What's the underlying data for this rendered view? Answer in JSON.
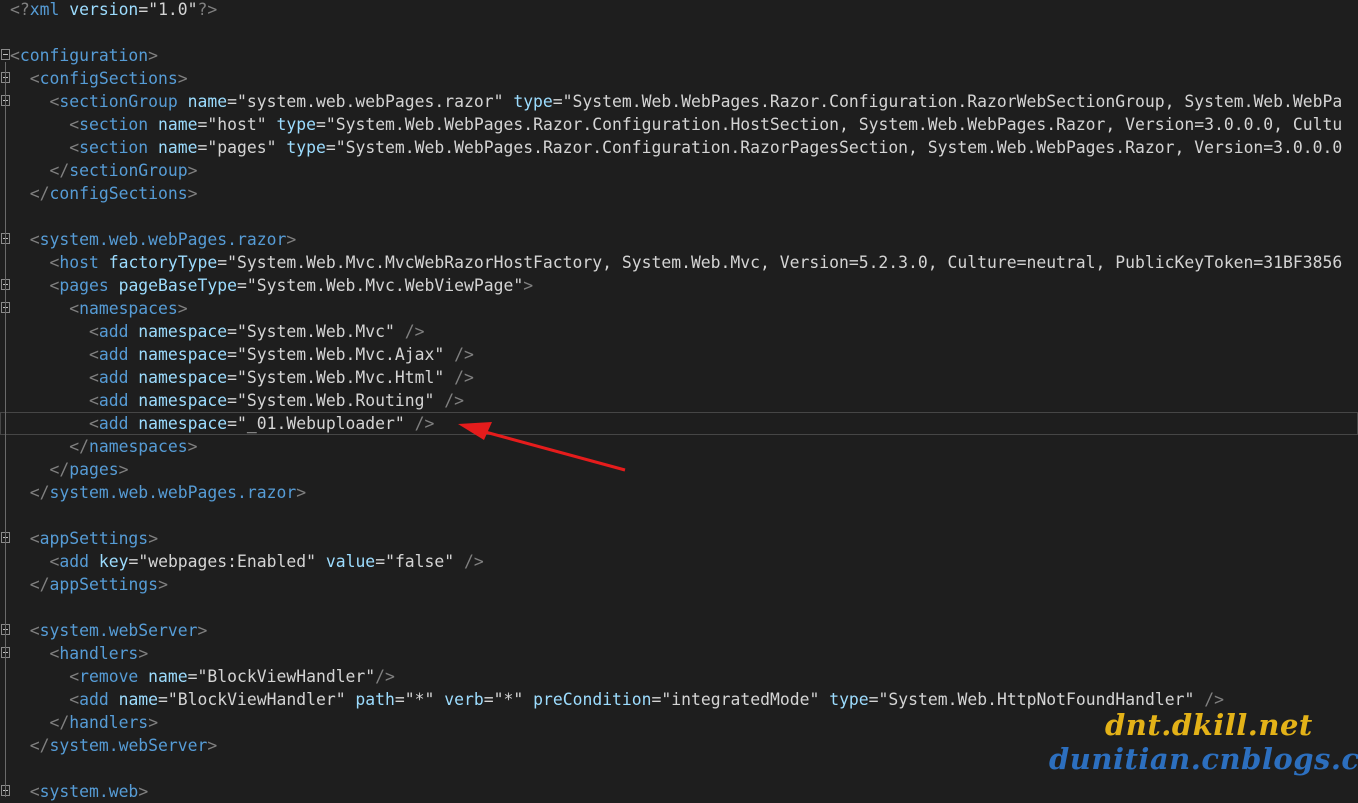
{
  "lines": [
    [
      [
        "pi",
        "<?"
      ],
      [
        "tag",
        "xml"
      ],
      [
        "attr",
        " version"
      ],
      [
        "eq",
        "="
      ],
      [
        "q",
        "\""
      ],
      [
        "val",
        "1.0"
      ],
      [
        "q",
        "\""
      ],
      [
        "pi",
        "?>"
      ]
    ],
    [],
    [
      [
        "delim",
        "<"
      ],
      [
        "tag",
        "configuration"
      ],
      [
        "delim",
        ">"
      ]
    ],
    [
      [
        "sp",
        "  "
      ],
      [
        "delim",
        "<"
      ],
      [
        "tag",
        "configSections"
      ],
      [
        "delim",
        ">"
      ]
    ],
    [
      [
        "sp",
        "    "
      ],
      [
        "delim",
        "<"
      ],
      [
        "tag",
        "sectionGroup"
      ],
      [
        "attr",
        " name"
      ],
      [
        "eq",
        "="
      ],
      [
        "q",
        "\""
      ],
      [
        "val",
        "system.web.webPages.razor"
      ],
      [
        "q",
        "\""
      ],
      [
        "attr",
        " type"
      ],
      [
        "eq",
        "="
      ],
      [
        "q",
        "\""
      ],
      [
        "val",
        "System.Web.WebPages.Razor.Configuration.RazorWebSectionGroup, System.Web.WebPa"
      ]
    ],
    [
      [
        "sp",
        "      "
      ],
      [
        "delim",
        "<"
      ],
      [
        "tag",
        "section"
      ],
      [
        "attr",
        " name"
      ],
      [
        "eq",
        "="
      ],
      [
        "q",
        "\""
      ],
      [
        "val",
        "host"
      ],
      [
        "q",
        "\""
      ],
      [
        "attr",
        " type"
      ],
      [
        "eq",
        "="
      ],
      [
        "q",
        "\""
      ],
      [
        "val",
        "System.Web.WebPages.Razor.Configuration.HostSection, System.Web.WebPages.Razor, Version=3.0.0.0, Cultu"
      ]
    ],
    [
      [
        "sp",
        "      "
      ],
      [
        "delim",
        "<"
      ],
      [
        "tag",
        "section"
      ],
      [
        "attr",
        " name"
      ],
      [
        "eq",
        "="
      ],
      [
        "q",
        "\""
      ],
      [
        "val",
        "pages"
      ],
      [
        "q",
        "\""
      ],
      [
        "attr",
        " type"
      ],
      [
        "eq",
        "="
      ],
      [
        "q",
        "\""
      ],
      [
        "val",
        "System.Web.WebPages.Razor.Configuration.RazorPagesSection, System.Web.WebPages.Razor, Version=3.0.0.0"
      ]
    ],
    [
      [
        "sp",
        "    "
      ],
      [
        "delim",
        "</"
      ],
      [
        "tag",
        "sectionGroup"
      ],
      [
        "delim",
        ">"
      ]
    ],
    [
      [
        "sp",
        "  "
      ],
      [
        "delim",
        "</"
      ],
      [
        "tag",
        "configSections"
      ],
      [
        "delim",
        ">"
      ]
    ],
    [],
    [
      [
        "sp",
        "  "
      ],
      [
        "delim",
        "<"
      ],
      [
        "tag",
        "system.web.webPages.razor"
      ],
      [
        "delim",
        ">"
      ]
    ],
    [
      [
        "sp",
        "    "
      ],
      [
        "delim",
        "<"
      ],
      [
        "tag",
        "host"
      ],
      [
        "attr",
        " factoryType"
      ],
      [
        "eq",
        "="
      ],
      [
        "q",
        "\""
      ],
      [
        "val",
        "System.Web.Mvc.MvcWebRazorHostFactory, System.Web.Mvc, Version=5.2.3.0, Culture=neutral, PublicKeyToken=31BF3856"
      ]
    ],
    [
      [
        "sp",
        "    "
      ],
      [
        "delim",
        "<"
      ],
      [
        "tag",
        "pages"
      ],
      [
        "attr",
        " pageBaseType"
      ],
      [
        "eq",
        "="
      ],
      [
        "q",
        "\""
      ],
      [
        "val",
        "System.Web.Mvc.WebViewPage"
      ],
      [
        "q",
        "\""
      ],
      [
        "delim",
        ">"
      ]
    ],
    [
      [
        "sp",
        "      "
      ],
      [
        "delim",
        "<"
      ],
      [
        "tag",
        "namespaces"
      ],
      [
        "delim",
        ">"
      ]
    ],
    [
      [
        "sp",
        "        "
      ],
      [
        "delim",
        "<"
      ],
      [
        "tag",
        "add"
      ],
      [
        "attr",
        " namespace"
      ],
      [
        "eq",
        "="
      ],
      [
        "q",
        "\""
      ],
      [
        "val",
        "System.Web.Mvc"
      ],
      [
        "q",
        "\""
      ],
      [
        "delim",
        " />"
      ]
    ],
    [
      [
        "sp",
        "        "
      ],
      [
        "delim",
        "<"
      ],
      [
        "tag",
        "add"
      ],
      [
        "attr",
        " namespace"
      ],
      [
        "eq",
        "="
      ],
      [
        "q",
        "\""
      ],
      [
        "val",
        "System.Web.Mvc.Ajax"
      ],
      [
        "q",
        "\""
      ],
      [
        "delim",
        " />"
      ]
    ],
    [
      [
        "sp",
        "        "
      ],
      [
        "delim",
        "<"
      ],
      [
        "tag",
        "add"
      ],
      [
        "attr",
        " namespace"
      ],
      [
        "eq",
        "="
      ],
      [
        "q",
        "\""
      ],
      [
        "val",
        "System.Web.Mvc.Html"
      ],
      [
        "q",
        "\""
      ],
      [
        "delim",
        " />"
      ]
    ],
    [
      [
        "sp",
        "        "
      ],
      [
        "delim",
        "<"
      ],
      [
        "tag",
        "add"
      ],
      [
        "attr",
        " namespace"
      ],
      [
        "eq",
        "="
      ],
      [
        "q",
        "\""
      ],
      [
        "val",
        "System.Web.Routing"
      ],
      [
        "q",
        "\""
      ],
      [
        "delim",
        " />"
      ]
    ],
    [
      [
        "sp",
        "        "
      ],
      [
        "delim",
        "<"
      ],
      [
        "tag",
        "add"
      ],
      [
        "attr",
        " namespace"
      ],
      [
        "eq",
        "="
      ],
      [
        "q",
        "\""
      ],
      [
        "val",
        "_01.Webuploader"
      ],
      [
        "q",
        "\""
      ],
      [
        "delim",
        " />"
      ]
    ],
    [
      [
        "sp",
        "      "
      ],
      [
        "delim",
        "</"
      ],
      [
        "tag",
        "namespaces"
      ],
      [
        "delim",
        ">"
      ]
    ],
    [
      [
        "sp",
        "    "
      ],
      [
        "delim",
        "</"
      ],
      [
        "tag",
        "pages"
      ],
      [
        "delim",
        ">"
      ]
    ],
    [
      [
        "sp",
        "  "
      ],
      [
        "delim",
        "</"
      ],
      [
        "tag",
        "system.web.webPages.razor"
      ],
      [
        "delim",
        ">"
      ]
    ],
    [],
    [
      [
        "sp",
        "  "
      ],
      [
        "delim",
        "<"
      ],
      [
        "tag",
        "appSettings"
      ],
      [
        "delim",
        ">"
      ]
    ],
    [
      [
        "sp",
        "    "
      ],
      [
        "delim",
        "<"
      ],
      [
        "tag",
        "add"
      ],
      [
        "attr",
        " key"
      ],
      [
        "eq",
        "="
      ],
      [
        "q",
        "\""
      ],
      [
        "val",
        "webpages:Enabled"
      ],
      [
        "q",
        "\""
      ],
      [
        "attr",
        " value"
      ],
      [
        "eq",
        "="
      ],
      [
        "q",
        "\""
      ],
      [
        "val",
        "false"
      ],
      [
        "q",
        "\""
      ],
      [
        "delim",
        " />"
      ]
    ],
    [
      [
        "sp",
        "  "
      ],
      [
        "delim",
        "</"
      ],
      [
        "tag",
        "appSettings"
      ],
      [
        "delim",
        ">"
      ]
    ],
    [],
    [
      [
        "sp",
        "  "
      ],
      [
        "delim",
        "<"
      ],
      [
        "tag",
        "system.webServer"
      ],
      [
        "delim",
        ">"
      ]
    ],
    [
      [
        "sp",
        "    "
      ],
      [
        "delim",
        "<"
      ],
      [
        "tag",
        "handlers"
      ],
      [
        "delim",
        ">"
      ]
    ],
    [
      [
        "sp",
        "      "
      ],
      [
        "delim",
        "<"
      ],
      [
        "tag",
        "remove"
      ],
      [
        "attr",
        " name"
      ],
      [
        "eq",
        "="
      ],
      [
        "q",
        "\""
      ],
      [
        "val",
        "BlockViewHandler"
      ],
      [
        "q",
        "\""
      ],
      [
        "delim",
        "/>"
      ]
    ],
    [
      [
        "sp",
        "      "
      ],
      [
        "delim",
        "<"
      ],
      [
        "tag",
        "add"
      ],
      [
        "attr",
        " name"
      ],
      [
        "eq",
        "="
      ],
      [
        "q",
        "\""
      ],
      [
        "val",
        "BlockViewHandler"
      ],
      [
        "q",
        "\""
      ],
      [
        "attr",
        " path"
      ],
      [
        "eq",
        "="
      ],
      [
        "q",
        "\""
      ],
      [
        "val",
        "*"
      ],
      [
        "q",
        "\""
      ],
      [
        "attr",
        " verb"
      ],
      [
        "eq",
        "="
      ],
      [
        "q",
        "\""
      ],
      [
        "val",
        "*"
      ],
      [
        "q",
        "\""
      ],
      [
        "attr",
        " preCondition"
      ],
      [
        "eq",
        "="
      ],
      [
        "q",
        "\""
      ],
      [
        "val",
        "integratedMode"
      ],
      [
        "q",
        "\""
      ],
      [
        "attr",
        " type"
      ],
      [
        "eq",
        "="
      ],
      [
        "q",
        "\""
      ],
      [
        "val",
        "System.Web.HttpNotFoundHandler"
      ],
      [
        "q",
        "\""
      ],
      [
        "delim",
        " />"
      ]
    ],
    [
      [
        "sp",
        "    "
      ],
      [
        "delim",
        "</"
      ],
      [
        "tag",
        "handlers"
      ],
      [
        "delim",
        ">"
      ]
    ],
    [
      [
        "sp",
        "  "
      ],
      [
        "delim",
        "</"
      ],
      [
        "tag",
        "system.webServer"
      ],
      [
        "delim",
        ">"
      ]
    ],
    [],
    [
      [
        "sp",
        "  "
      ],
      [
        "delim",
        "<"
      ],
      [
        "tag",
        "system.web"
      ],
      [
        "delim",
        ">"
      ]
    ]
  ],
  "folds": [
    2,
    3,
    4,
    10,
    12,
    13,
    23,
    27,
    28,
    34
  ],
  "current_line": 18,
  "watermark": {
    "line1": "dnt.dkill.net",
    "line2": "dunitian.cnblogs.com"
  },
  "colors": {
    "background": "#1e1e1e",
    "tag": "#569cd6",
    "attribute": "#9cdcfe",
    "delimiter": "#808080",
    "value": "#d4d4d4",
    "arrow": "#e51c1c",
    "watermark1": "#e3b218",
    "watermark2": "#2c6fbf"
  }
}
